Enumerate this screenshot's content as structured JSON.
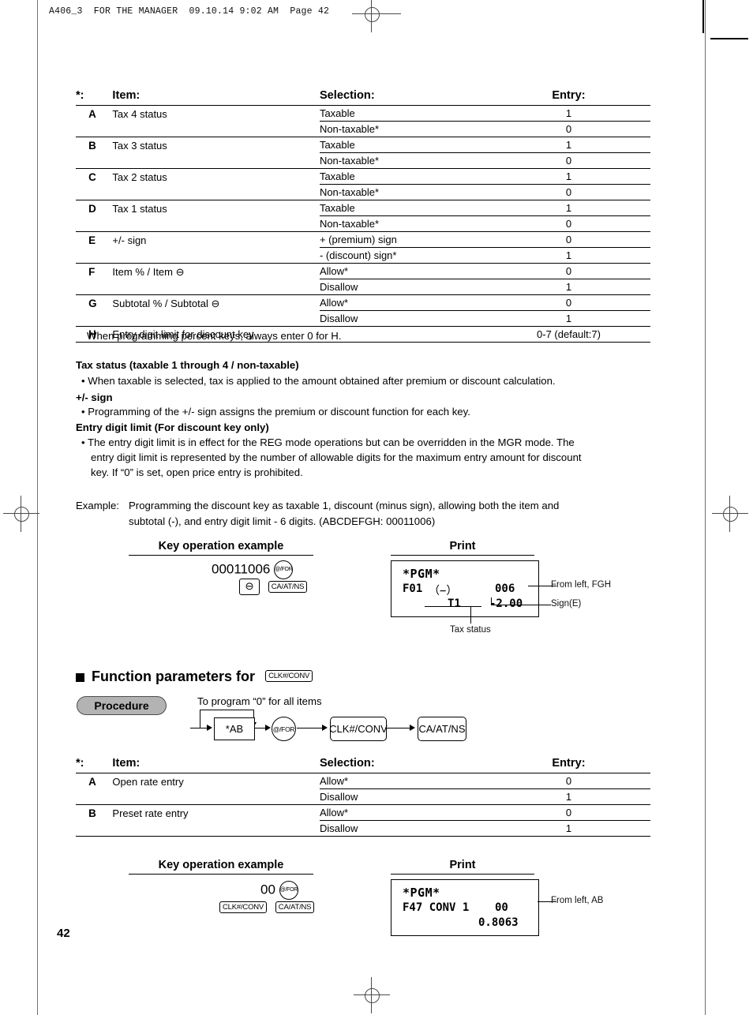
{
  "page": {
    "header_strip": "A406_3  FOR THE MANAGER  09.10.14 9:02 AM  Page 42",
    "page_number": "42"
  },
  "table1": {
    "headers": {
      "star": "*:",
      "item": "Item:",
      "selection": "Selection:",
      "entry": "Entry:"
    },
    "rows": [
      {
        "letter": "A",
        "item": "Tax 4 status",
        "selection": "Taxable",
        "entry": "1"
      },
      {
        "letter": "",
        "item": "",
        "selection": "Non-taxable*",
        "entry": "0"
      },
      {
        "letter": "B",
        "item": "Tax 3 status",
        "selection": "Taxable",
        "entry": "1"
      },
      {
        "letter": "",
        "item": "",
        "selection": "Non-taxable*",
        "entry": "0"
      },
      {
        "letter": "C",
        "item": "Tax 2 status",
        "selection": "Taxable",
        "entry": "1"
      },
      {
        "letter": "",
        "item": "",
        "selection": "Non-taxable*",
        "entry": "0"
      },
      {
        "letter": "D",
        "item": "Tax 1 status",
        "selection": "Taxable",
        "entry": "1"
      },
      {
        "letter": "",
        "item": "",
        "selection": "Non-taxable*",
        "entry": "0"
      },
      {
        "letter": "E",
        "item": "+/- sign",
        "selection": "+ (premium) sign",
        "entry": "0"
      },
      {
        "letter": "",
        "item": "",
        "selection": "- (discount) sign*",
        "entry": "1"
      },
      {
        "letter": "F",
        "item": "Item % / Item ⊖",
        "selection": "Allow*",
        "entry": "0"
      },
      {
        "letter": "",
        "item": "",
        "selection": "Disallow",
        "entry": "1"
      },
      {
        "letter": "G",
        "item": "Subtotal % / Subtotal ⊖",
        "selection": "Allow*",
        "entry": "0"
      },
      {
        "letter": "",
        "item": "",
        "selection": "Disallow",
        "entry": "1"
      }
    ],
    "last_row": {
      "letter": "H",
      "item": "Entry digit limit for discount key",
      "entry": "0-7 (default:7)"
    },
    "note": "When programming percent keys, always enter 0 for H."
  },
  "notes": {
    "h1": "Tax status (taxable 1 through 4 / non-taxable)",
    "b1": "• When taxable is selected, tax is applied to the amount obtained after premium or discount calculation.",
    "h2": "+/- sign",
    "b2": "• Programming of the +/- sign assigns the premium or discount function for each key.",
    "h3": "Entry digit limit (For discount key only)",
    "b3_l1": "• The entry digit limit is in effect for the REG mode operations but can be overridden in the MGR mode.  The",
    "b3_l2": "entry digit limit is represented by the number of allowable digits for the maximum entry amount for discount",
    "b3_l3": "key.  If “0” is set, open price entry is prohibited."
  },
  "example1": {
    "label": "Example:",
    "line1": "Programming the discount key as taxable 1, discount (minus sign), allowing both the item and",
    "line2": "subtotal (-), and entry digit limit - 6 digits.  (ABCDEFGH: 00011006)",
    "caption_keyop": "Key operation example",
    "caption_print": "Print",
    "keyop": {
      "digits": "00011006",
      "key_for": "@/FOR",
      "key_minus": "⊖",
      "key_caatns": "CA/AT/NS"
    },
    "print": {
      "line_pgm": "*PGM*",
      "line_f": "F01",
      "line_f_paren": "（−）",
      "line_f_right": "006",
      "line_t": "T1",
      "line_amount": "-2.00"
    },
    "callouts": {
      "fgh": "From left, FGH",
      "sign": "Sign(E)",
      "tax_status": "Tax status"
    }
  },
  "section2": {
    "heading": "Function parameters for",
    "heading_key": "CLK#/CONV",
    "procedure_label": "Procedure",
    "bypass_label": "To program “0” for all items",
    "flow": {
      "ab": "*AB",
      "for": "@/FOR",
      "clk": "CLK#/CONV",
      "caatns": "CA/AT/NS"
    }
  },
  "table2": {
    "headers": {
      "star": "*:",
      "item": "Item:",
      "selection": "Selection:",
      "entry": "Entry:"
    },
    "rows": [
      {
        "letter": "A",
        "item": "Open rate entry",
        "selection": "Allow*",
        "entry": "0"
      },
      {
        "letter": "",
        "item": "",
        "selection": "Disallow",
        "entry": "1"
      },
      {
        "letter": "B",
        "item": "Preset rate entry",
        "selection": "Allow*",
        "entry": "0"
      },
      {
        "letter": "",
        "item": "",
        "selection": "Disallow",
        "entry": "1"
      }
    ]
  },
  "example2": {
    "caption_keyop": "Key operation example",
    "caption_print": "Print",
    "keyop": {
      "digits": "00",
      "key_for": "@/FOR",
      "key_clk": "CLK#/CONV",
      "key_caatns": "CA/AT/NS"
    },
    "print": {
      "line_pgm": "*PGM*",
      "line_f": "F47 CONV 1",
      "line_f_right": "00",
      "line_rate": "0.8063"
    },
    "callouts": {
      "ab": "From left, AB"
    }
  }
}
